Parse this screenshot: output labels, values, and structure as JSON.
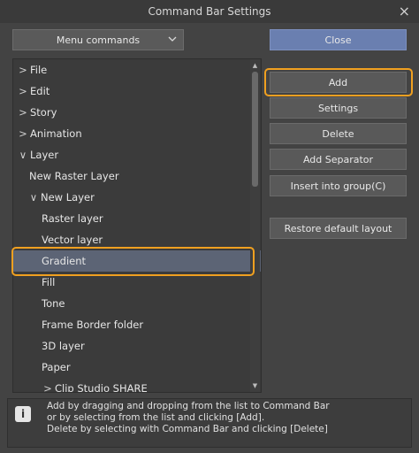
{
  "window": {
    "title": "Command Bar Settings"
  },
  "dropdown": {
    "value": "Menu commands"
  },
  "list": {
    "items": [
      {
        "label": "File",
        "expander": "right"
      },
      {
        "label": "Edit",
        "expander": "right"
      },
      {
        "label": "Story",
        "expander": "right"
      },
      {
        "label": "Animation",
        "expander": "right"
      },
      {
        "label": "Layer",
        "expander": "down"
      },
      {
        "label": "New Raster Layer",
        "expander": ""
      },
      {
        "label": "New Layer",
        "expander": "down"
      },
      {
        "label": "Raster layer",
        "expander": ""
      },
      {
        "label": "Vector layer",
        "expander": ""
      },
      {
        "label": "Gradient",
        "expander": "",
        "selected": true
      },
      {
        "label": "Fill",
        "expander": ""
      },
      {
        "label": "Tone",
        "expander": ""
      },
      {
        "label": "Frame Border folder",
        "expander": ""
      },
      {
        "label": "3D layer",
        "expander": ""
      },
      {
        "label": "Paper",
        "expander": ""
      },
      {
        "label": "Clip Studio SHARE",
        "expander": "right"
      }
    ]
  },
  "buttons": {
    "close": "Close",
    "add": "Add",
    "settings": "Settings",
    "delete": "Delete",
    "add_separator": "Add Separator",
    "insert_group": "Insert into group(C)",
    "restore": "Restore default layout"
  },
  "info": {
    "line1": "Add by dragging and dropping from the list to Command Bar",
    "line2": "or by selecting from the list and clicking [Add].",
    "line3": "Delete by selecting with Command Bar and clicking [Delete]"
  },
  "colors": {
    "highlight": "#f0a020",
    "selection": "#5c6475",
    "primary_button": "#6a7fb0"
  }
}
